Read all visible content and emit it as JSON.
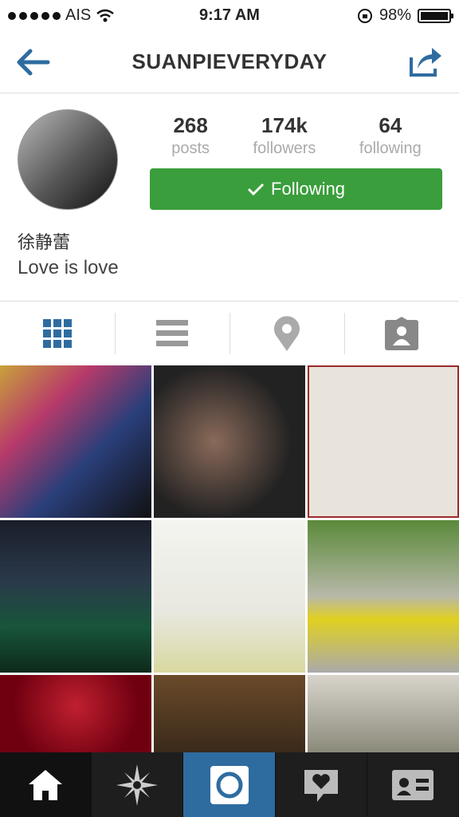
{
  "status_bar": {
    "carrier": "AIS",
    "time": "9:17 AM",
    "battery": "98%",
    "icons": [
      "signal-dots-icon",
      "wifi-icon",
      "rotation-lock-icon",
      "battery-icon"
    ]
  },
  "nav": {
    "title": "SUANPIEVERYDAY",
    "back_icon": "back-arrow-icon",
    "share_icon": "share-icon"
  },
  "profile": {
    "stats": [
      {
        "value": "268",
        "label": "posts"
      },
      {
        "value": "174k",
        "label": "followers"
      },
      {
        "value": "64",
        "label": "following"
      }
    ],
    "follow_button": "Following",
    "name": "徐静蕾",
    "bio": "Love is love"
  },
  "view_tabs": [
    "grid-icon",
    "list-icon",
    "location-icon",
    "tagged-icon"
  ],
  "bottom_tabs": [
    "home-icon",
    "explore-icon",
    "camera-icon",
    "activity-icon",
    "profile-icon"
  ],
  "colors": {
    "follow_green": "#3a9e3c",
    "accent_blue": "#2e6ca0",
    "tabbar": "#1e1e1e"
  }
}
